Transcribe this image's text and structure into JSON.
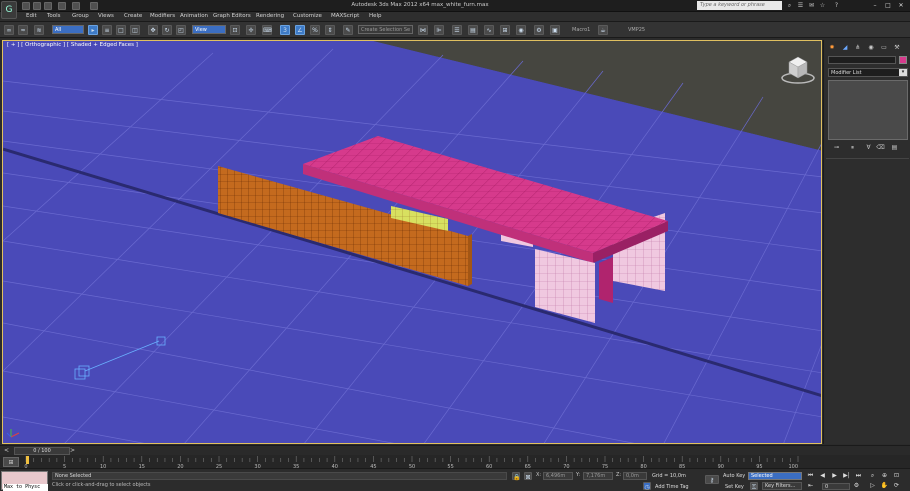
{
  "titlebar": {
    "title": "Autodesk 3ds Max 2012 x64     max_white_furn.max",
    "search_placeholder": "Type a keyword or phrase"
  },
  "menu": [
    "Edit",
    "Tools",
    "Group",
    "Views",
    "Create",
    "Modifiers",
    "Animation",
    "Graph Editors",
    "Rendering",
    "Customize",
    "MAXScript",
    "Help"
  ],
  "toolbar": {
    "selection_filter": "All",
    "ref_coord": "View",
    "named_selection": "Create Selection Se",
    "macro1": "Macro1",
    "macro2": "VMP25"
  },
  "viewport": {
    "label": "[ + ] [ Orthographic ] [ Shaded + Edged Faces ]"
  },
  "command_panel": {
    "modifier_list": "Modifier List"
  },
  "time_slider": {
    "frame_label": "0 / 100"
  },
  "trackbar": {
    "ticks": [
      "0",
      "5",
      "10",
      "15",
      "20",
      "25",
      "30",
      "35",
      "40",
      "45",
      "50",
      "55",
      "60",
      "65",
      "70",
      "75",
      "80",
      "85",
      "90",
      "95",
      "100"
    ]
  },
  "status": {
    "maxscript_label": "Max to Physc",
    "selection": "None Selected",
    "prompt": "Click or click-and-drag to select objects",
    "x_value": "6,496m",
    "y_value": "7,176m",
    "z_value": "0,0m",
    "grid": "Grid = 10,0m",
    "add_time_tag": "Add Time Tag",
    "auto_key": "Auto Key",
    "set_key": "Set Key",
    "selected": "Selected",
    "key_filters": "Key Filters...",
    "frame": "0"
  },
  "colors": {
    "viewport_bg": "#4a4ab8",
    "tabletop": "#d63a8c",
    "legs": "#f0c8e0",
    "panel": "#c46a1e",
    "shelf": "#d8e060",
    "viewport_border": "#e0c060"
  }
}
